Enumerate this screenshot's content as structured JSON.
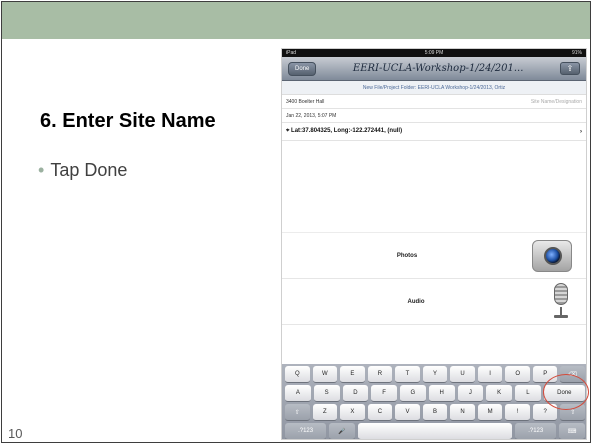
{
  "slide": {
    "heading": "6. Enter Site Name",
    "bullet": "Tap Done",
    "page_number": "10"
  },
  "ipad": {
    "status_left": "iPad",
    "status_time": "5:09 PM",
    "status_right": "91%",
    "nav": {
      "back_label": "Done",
      "title": "EERI-UCLA-Workshop-1/24/201...",
      "share_icon": "share-icon"
    },
    "folder_line": "New File/Project Folder: EERI-UCLA Workshop-1/24/2013, Ortiz",
    "rows": [
      {
        "label": "3400 Boelter Hall",
        "hint": "Site Name/Designation"
      },
      {
        "label": "Jan 22, 2013, 5:07 PM",
        "hint": ""
      }
    ],
    "location_line": "Lat:37.804325, Long:-122.272441, (null)",
    "media": [
      {
        "label": "Photos",
        "icon": "camera-icon"
      },
      {
        "label": "Audio",
        "icon": "microphone-icon"
      }
    ],
    "keyboard": {
      "row1": [
        "Q",
        "W",
        "E",
        "R",
        "T",
        "Y",
        "U",
        "I",
        "O",
        "P",
        "⌫"
      ],
      "row2": [
        "A",
        "S",
        "D",
        "F",
        "G",
        "H",
        "J",
        "K",
        "L",
        "Done"
      ],
      "row3": [
        "⇧",
        "Z",
        "X",
        "C",
        "V",
        "B",
        "N",
        "M",
        "!",
        "?",
        "⇧"
      ],
      "row4": [
        ".?123",
        "🎤",
        "",
        ".?123",
        "⌨"
      ]
    }
  },
  "colors": {
    "band": "#a8bda5",
    "callout": "#d44a3a"
  }
}
